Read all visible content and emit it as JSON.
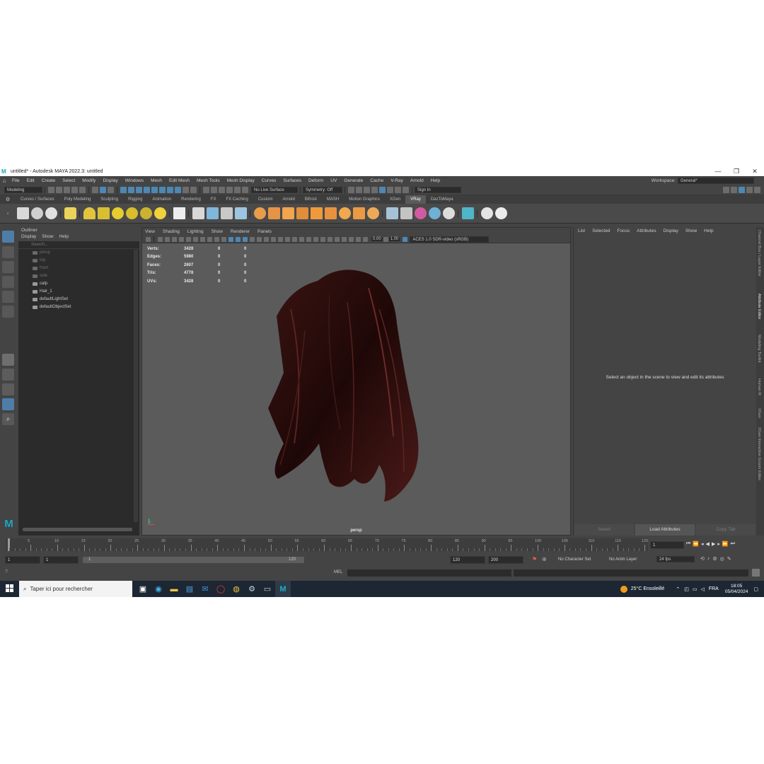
{
  "window": {
    "title": "untitled* - Autodesk MAYA 2022.3: untitled",
    "min": "—",
    "max": "❐",
    "close": "✕"
  },
  "menubar": {
    "items": [
      "File",
      "Edit",
      "Create",
      "Select",
      "Modify",
      "Display",
      "Windows",
      "Mesh",
      "Edit Mesh",
      "Mesh Tools",
      "Mesh Display",
      "Curves",
      "Surfaces",
      "Deform",
      "UV",
      "Generate",
      "Cache",
      "V-Ray",
      "Arnold",
      "Help"
    ],
    "workspace_label": "Workspace:",
    "workspace_value": "General*"
  },
  "toolbar": {
    "mode": "Modeling",
    "live_surface": "No Live Surface",
    "symmetry": "Symmetry: Off",
    "sign_in": "Sign In"
  },
  "shelf": {
    "tabs": [
      "Curves / Surfaces",
      "Poly Modeling",
      "Sculpting",
      "Rigging",
      "Animation",
      "Rendering",
      "FX",
      "FX Caching",
      "Custom",
      "Arnold",
      "Bifrost",
      "MASH",
      "Motion Graphics",
      "XGen",
      "VRay",
      "DazToMaya"
    ],
    "active_tab": "VRay"
  },
  "outliner": {
    "title": "Outliner",
    "menu": [
      "Display",
      "Show",
      "Help"
    ],
    "search_placeholder": "Search...",
    "items": [
      {
        "label": "persp",
        "dim": true
      },
      {
        "label": "top",
        "dim": true
      },
      {
        "label": "front",
        "dim": true
      },
      {
        "label": "side",
        "dim": true
      },
      {
        "label": "calp",
        "dim": false
      },
      {
        "label": "Hair_1",
        "dim": false
      },
      {
        "label": "defaultLightSet",
        "dim": false
      },
      {
        "label": "defaultObjectSet",
        "dim": false
      }
    ]
  },
  "viewport": {
    "menu": [
      "View",
      "Shading",
      "Lighting",
      "Show",
      "Renderer",
      "Panels"
    ],
    "exposure": "0.00",
    "gamma": "1.00",
    "color_space": "ACES 1.0 SDR-video (sRGB)",
    "camera_label": "persp",
    "hud": [
      {
        "label": "Verts:",
        "v1": "3428",
        "v2": "0",
        "v3": "0"
      },
      {
        "label": "Edges:",
        "v1": "5980",
        "v2": "0",
        "v3": "0"
      },
      {
        "label": "Faces:",
        "v1": "2607",
        "v2": "0",
        "v3": "0"
      },
      {
        "label": "Tris:",
        "v1": "4778",
        "v2": "0",
        "v3": "0"
      },
      {
        "label": "UVs:",
        "v1": "3428",
        "v2": "0",
        "v3": "0"
      }
    ]
  },
  "attribute_editor": {
    "menu": [
      "List",
      "Selected",
      "Focus",
      "Attributes",
      "Display",
      "Show",
      "Help"
    ],
    "message": "Select an object in the scene to view and edit its attributes",
    "buttons": [
      "Select",
      "Load Attributes",
      "Copy Tab"
    ]
  },
  "side_tabs": [
    "Channel Box / Layer Editor",
    "Attribute Editor",
    "Modeling Toolkit",
    "Human IK",
    "XGen",
    "XGen Interactive Groom Editor"
  ],
  "timeline": {
    "ticks": [
      "5",
      "10",
      "15",
      "20",
      "25",
      "30",
      "35",
      "40",
      "45",
      "50",
      "55",
      "60",
      "65",
      "70",
      "75",
      "80",
      "85",
      "90",
      "95",
      "100",
      "105",
      "110",
      "115",
      "120"
    ],
    "current_frame": "1",
    "start": "1",
    "playback_start": "1",
    "range_left": "1",
    "range_right": "120",
    "playback_end": "120",
    "end": "200",
    "character_set": "No Character Set",
    "anim_layer": "No Anim Layer",
    "fps": "24 fps"
  },
  "command_line": {
    "lang": "MEL"
  },
  "taskbar": {
    "search_placeholder": "Taper ici pour rechercher",
    "weather": "25°C  Ensoleillé",
    "lang": "FRA",
    "time": "18:05",
    "date": "05/04/2024"
  }
}
